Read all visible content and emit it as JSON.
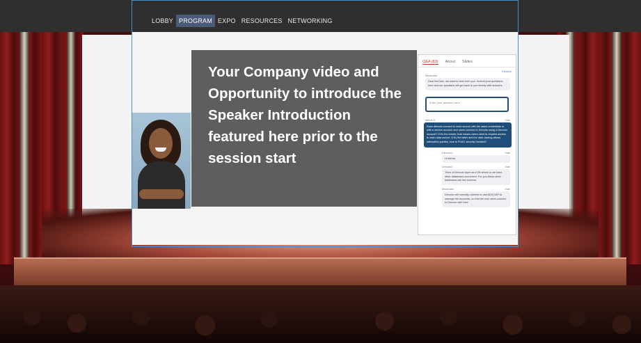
{
  "nav": {
    "items": [
      {
        "label": "LOBBY",
        "active": false
      },
      {
        "label": "PROGRAM",
        "active": true
      },
      {
        "label": "EXPO",
        "active": false
      },
      {
        "label": "RESOURCES",
        "active": false
      },
      {
        "label": "NETWORKING",
        "active": false
      }
    ]
  },
  "overlay": {
    "text": "Your Company video and Opportunity to introduce the Speaker Introduction featured here prior to the session start"
  },
  "qa": {
    "tabs": [
      {
        "label": "Q&A (83)",
        "active": true
      },
      {
        "label": "About",
        "active": false
      },
      {
        "label": "Slides",
        "active": false
      }
    ],
    "dismiss": "Dismiss",
    "moderator_label": "Moderator",
    "welcome": "Dear McClain, we want to hear from you. Submit your questions here and our speakers will get back to you shortly with answers.",
    "input_placeholder": "Enter your question here",
    "question_author": "Mehdi S.",
    "question_votes": "Vote",
    "question_text": "Does denodo connect to each source with the same credentials or with a service account and users connect to Denodo using a Denodo account? If it's the former, that means users need to request access to each data source. If it's the latter and the data catalog allows interactive queries, how is FGAC security handled?",
    "replies": [
      {
        "author": "Denodo1",
        "votes": "Vote",
        "text": "Hi Mehdi,"
      },
      {
        "author": "Denodo1",
        "votes": "Vote",
        "text": "Think of Denodo layer as a DB where in we have other databases connected. For you these other databases are like schema."
      },
      {
        "author": "Moderator",
        "votes": "Vote",
        "text": "Denodo will normally connect to and AD/LDAP to manage the accounts, so that the end users connect to Denodo with their"
      }
    ]
  },
  "colors": {
    "nav_active": "#4a5a78",
    "frame_border": "#4a90c8",
    "overlay_bg": "#555555",
    "question_bg": "#1f4e7a",
    "tab_active": "#c0392b"
  }
}
